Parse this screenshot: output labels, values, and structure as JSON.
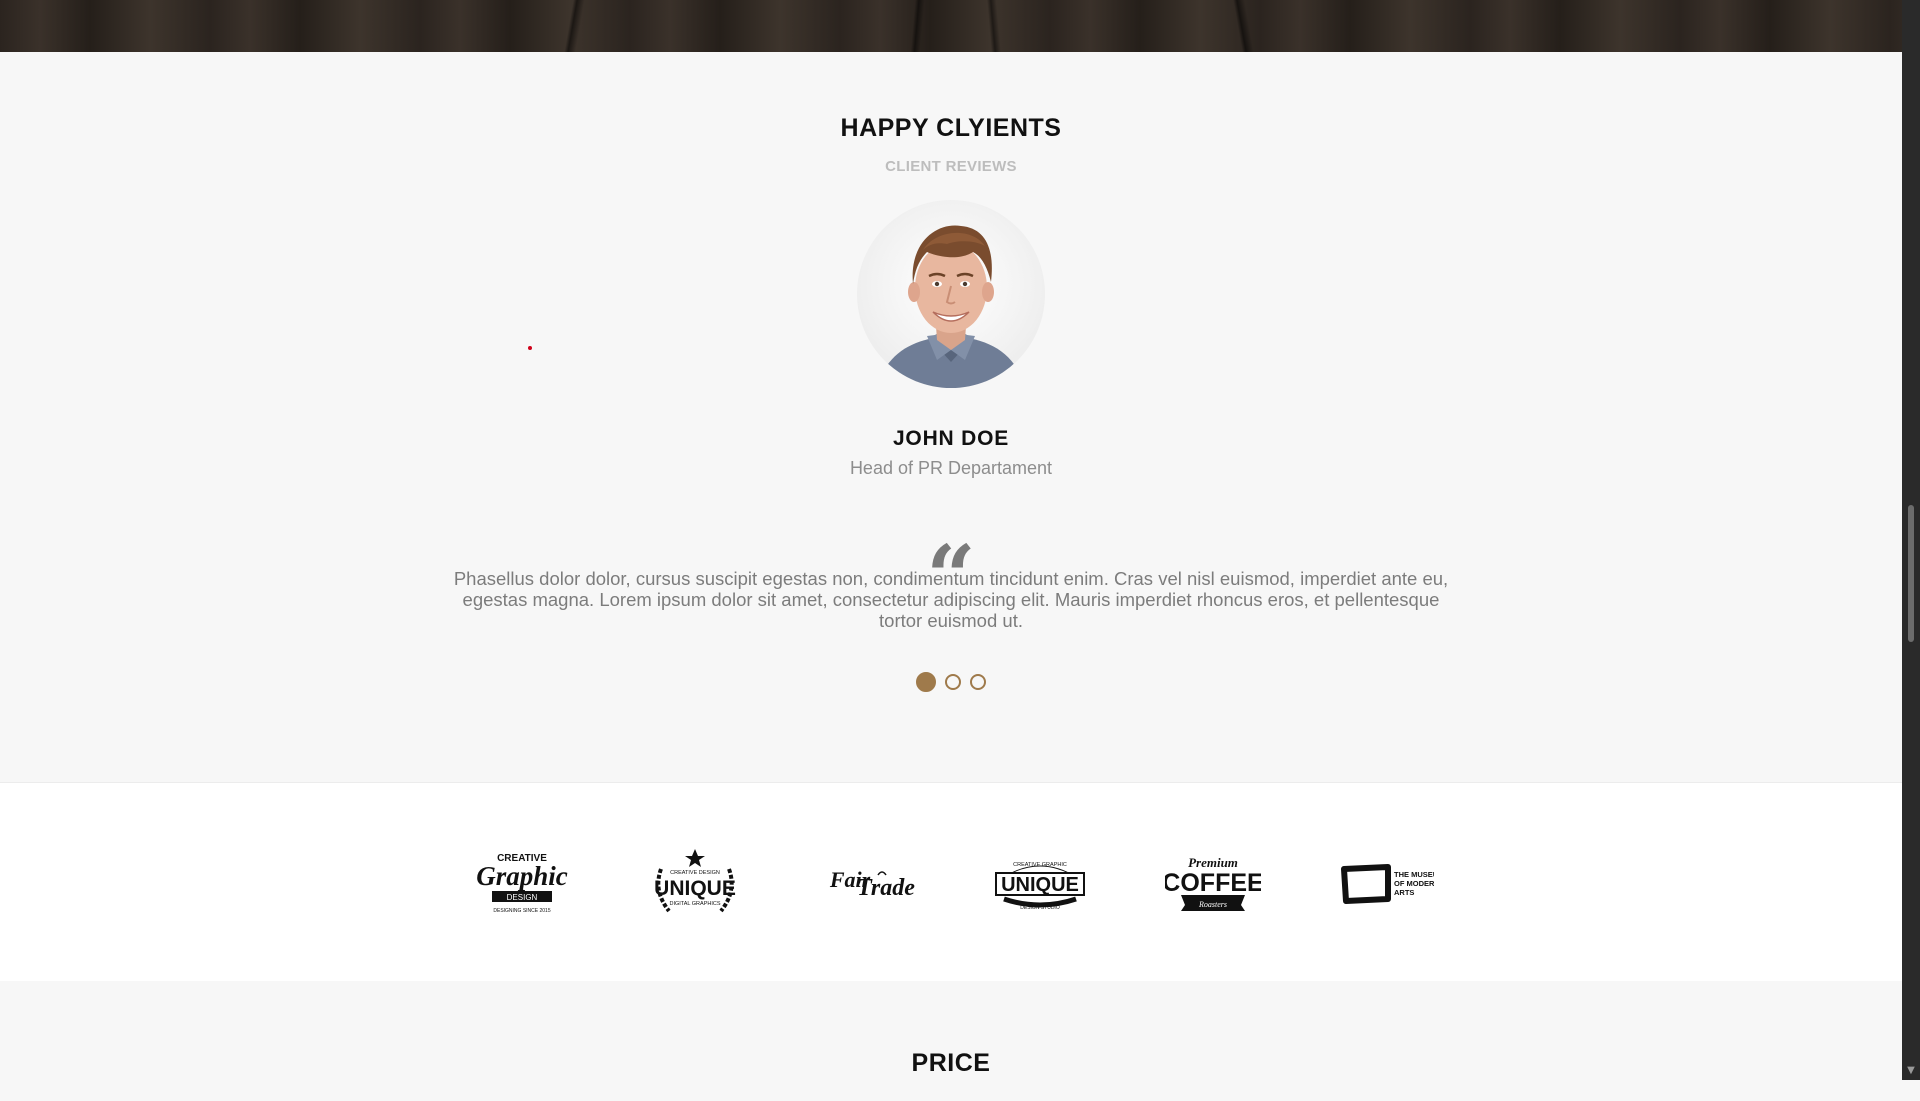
{
  "testimonials": {
    "title": "HAPPY CLYIENTS",
    "subtitle": "CLIENT REVIEWS",
    "client": {
      "name": "JOHN DOE",
      "role": "Head of PR Departament",
      "quote_mark": "“",
      "quote": "Phasellus dolor dolor, cursus suscipit egestas non, condimentum tincidunt enim. Cras vel nisl euismod, imperdiet ante eu, egestas magna. Lorem ipsum dolor sit amet, consectetur adipiscing elit. Mauris imperdiet rhoncus eros, et pellentesque tortor euismod ut."
    },
    "pagination": {
      "count": 3,
      "active_index": 0
    },
    "accent_color": "#9f7a4b"
  },
  "partners": {
    "logos": [
      {
        "icon": "creative-graphic-design-logo",
        "lines": [
          "CREATIVE",
          "Graphic",
          "DESIGN",
          "DESIGNING SINCE 2015"
        ]
      },
      {
        "icon": "unique-digital-graphics-logo",
        "lines": [
          "CREATIVE DESIGN",
          "UNIQUE",
          "DIGITAL GRAPHICS"
        ]
      },
      {
        "icon": "fair-trade-logo",
        "lines": [
          "Fair",
          "Trade"
        ]
      },
      {
        "icon": "unique-design-studio-logo",
        "lines": [
          "CREATIVE GRAPHIC",
          "UNIQUE",
          "DESIGN STUDIO"
        ]
      },
      {
        "icon": "premium-coffee-roasters-logo",
        "lines": [
          "Premium",
          "COFFEE",
          "Roasters"
        ]
      },
      {
        "icon": "museum-of-modern-arts-logo",
        "lines": [
          "THE MUSEUM",
          "OF MODERN",
          "ARTS"
        ]
      }
    ]
  },
  "pricing": {
    "title": "PRICE"
  }
}
